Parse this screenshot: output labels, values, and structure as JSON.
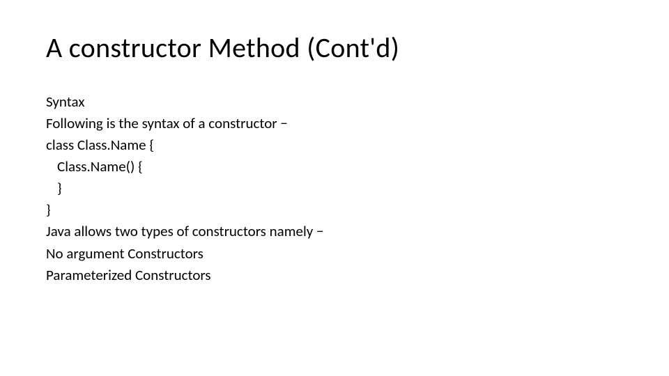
{
  "slide": {
    "title": "A constructor Method (Cont'd)",
    "body": {
      "line1": "Syntax",
      "line2": "Following is the syntax of a constructor −",
      "line3": "class Class.Name {",
      "line4": "Class.Name() {",
      "line5": "}",
      "line6": "}",
      "line7": "Java allows two types of constructors namely −",
      "line8": "No argument Constructors",
      "line9": "Parameterized Constructors"
    }
  }
}
